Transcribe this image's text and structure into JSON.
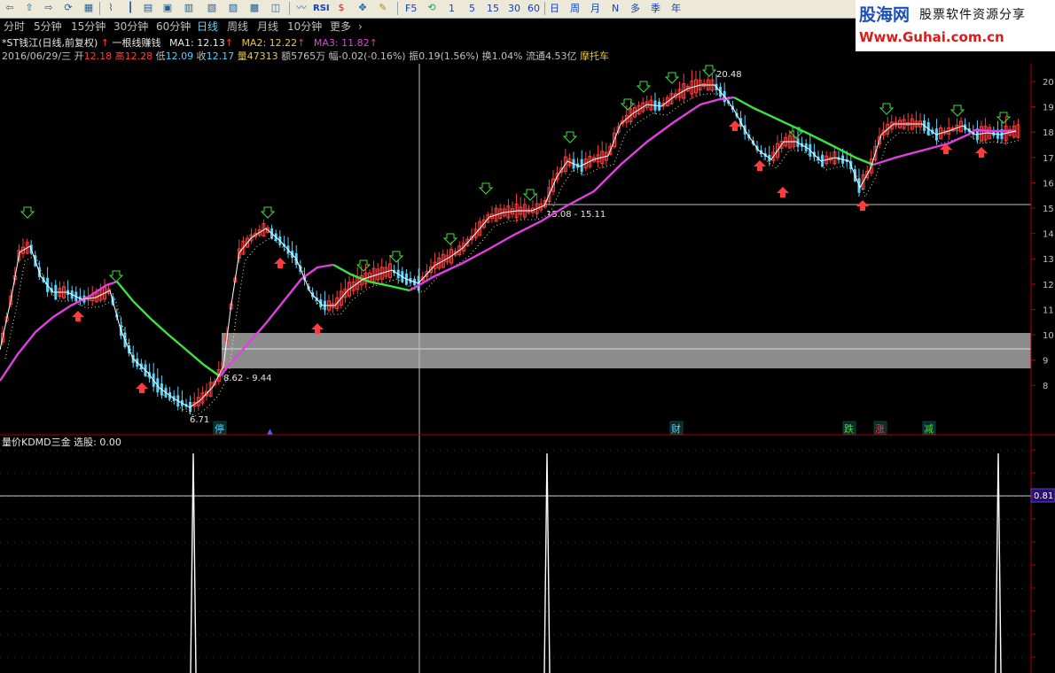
{
  "toolbar": {
    "icons": [
      "back-icon",
      "up-icon",
      "forward-icon",
      "down-icon",
      "layout-icon",
      "table-icon",
      "line-icon",
      "candle-icon",
      "bar-icon",
      "chart2-icon",
      "grid-icon",
      "f10-icon",
      "f2-icon",
      "f12-icon",
      "f9-icon",
      "f11-icon",
      "compare-icon"
    ],
    "rsi": "RSI",
    "f5": "F5",
    "nums": [
      "1",
      "5",
      "15",
      "30",
      "60"
    ],
    "cal": [
      "日",
      "周",
      "月",
      "N",
      "多",
      "季",
      "年"
    ]
  },
  "periods": [
    "分时",
    "5分钟",
    "15分钟",
    "30分钟",
    "60分钟",
    "日线",
    "周线",
    "月线",
    "10分钟",
    "更多",
    "›"
  ],
  "active_period": "日线",
  "brand": {
    "name": "股海网",
    "slogan": "股票软件资源分享",
    "url": "Www.Guhai.com.cn"
  },
  "stock": {
    "name": "*ST钱江(日线,前复权)",
    "indicator": "一根线赚钱",
    "ma1": "MA1: 12.13",
    "ma2": "MA2: 12.22",
    "ma3": "MA3: 11.82",
    "date": "2016/06/29/三",
    "open_label": "开",
    "open": "12.18",
    "high_label": "高",
    "high": "12.28",
    "low_label": "低",
    "low": "12.09",
    "close_label": "收",
    "close": "12.17",
    "vol_label": "量",
    "vol": "47313",
    "amount": "额5765万",
    "change": "幅-0.02(-0.16%)",
    "amp": "振0.19(1.56%)",
    "turnover": "换1.04%",
    "float": "流通4.53亿",
    "sector": "摩托车"
  },
  "annotations": {
    "high_peak": "20.48",
    "low_trough": "6.71",
    "range1": "8.62 - 9.44",
    "range2": "15.08 - 15.11",
    "events": [
      "停",
      "财",
      "跌",
      "涨",
      "减"
    ]
  },
  "price_axis": [
    "20",
    "19",
    "18",
    "17",
    "16",
    "15",
    "14",
    "13",
    "12",
    "11",
    "10",
    "9",
    "8"
  ],
  "sub": {
    "title": "量价KDMD三金",
    "select": "选股: 0.00",
    "value": "0.81"
  },
  "colors": {
    "up": "#ff3c3c",
    "down": "#54d4ff",
    "ma_green": "#3ee23e",
    "ma_magenta": "#e040e0",
    "bg": "#000000",
    "axis": "#b00000"
  }
}
